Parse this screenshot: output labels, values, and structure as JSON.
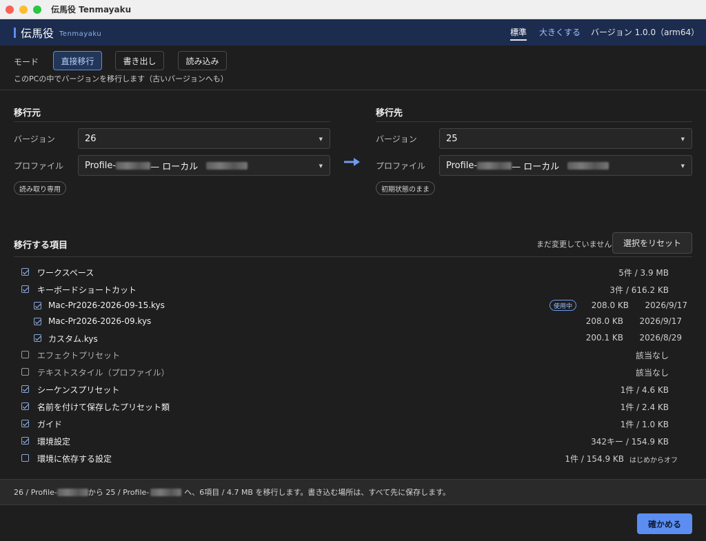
{
  "window": {
    "title": "伝馬役 Tenmayaku"
  },
  "header": {
    "brand": "伝馬役",
    "brand_sub": "Tenmayaku",
    "size_standard": "標準",
    "size_large": "大きくする",
    "version": "バージョン 1.0.0（arm64）"
  },
  "mode": {
    "label": "モード",
    "buttons": [
      "直接移行",
      "書き出し",
      "読み込み"
    ],
    "active": "直接移行",
    "description": "このPCの中でバージョンを移行します（古いバージョンへも）"
  },
  "source": {
    "title": "移行元",
    "version_label": "バージョン",
    "version_value": "26",
    "profile_label": "プロファイル",
    "profile_prefix": "Profile-",
    "profile_suffix": "— ローカル",
    "badge": "読み取り専用"
  },
  "target": {
    "title": "移行先",
    "version_label": "バージョン",
    "version_value": "25",
    "profile_label": "プロファイル",
    "profile_prefix": "Profile-",
    "profile_suffix": "— ローカル",
    "badge": "初期状態のまま"
  },
  "items": {
    "title": "移行する項目",
    "note": "まだ変更していません",
    "reset_label": "選択をリセット",
    "rows": [
      {
        "label": "ワークスペース",
        "checked": true,
        "meta": "5件 / 3.9 MB"
      },
      {
        "label": "キーボードショートカット",
        "checked": true,
        "meta": "3件 / 616.2 KB"
      },
      {
        "label": "Mac-Pr2026-2026-09-15.kys",
        "checked": true,
        "child": true,
        "badge": "使用中",
        "size": "208.0 KB",
        "date": "2026/9/17"
      },
      {
        "label": "Mac-Pr2026-2026-09.kys",
        "checked": true,
        "child": true,
        "size": "208.0 KB",
        "date": "2026/9/17"
      },
      {
        "label": "カスタム.kys",
        "checked": true,
        "child": true,
        "size": "200.1 KB",
        "date": "2026/8/29"
      },
      {
        "label": "エフェクトプリセット",
        "checked": false,
        "dim": true,
        "meta": "該当なし"
      },
      {
        "label": "テキストスタイル（プロファイル）",
        "checked": false,
        "dim": true,
        "meta": "該当なし"
      },
      {
        "label": "シーケンスプリセット",
        "checked": true,
        "meta": "1件 / 4.6 KB"
      },
      {
        "label": "名前を付けて保存したプリセット類",
        "checked": true,
        "meta": "1件 / 2.4 KB"
      },
      {
        "label": "ガイド",
        "checked": true,
        "meta": "1件 / 1.0 KB"
      },
      {
        "label": "環境設定",
        "checked": true,
        "meta": "342キー / 154.9 KB"
      },
      {
        "label": "環境に依存する設定",
        "checked": false,
        "meta": "1件 / 154.9 KB",
        "extra": "はじめからオフ"
      }
    ]
  },
  "summary": {
    "part1": "26 / Profile-",
    "part2": "から 25 / Profile-",
    "part3": "へ、6項目 / 4.7 MB を移行します。書き込む場所は、すべて先に保存します。"
  },
  "confirm_label": "確かめる",
  "colors": {
    "accent": "#5b8ef0",
    "header_bg": "#1c2c4f",
    "background": "#1e1e1e"
  }
}
